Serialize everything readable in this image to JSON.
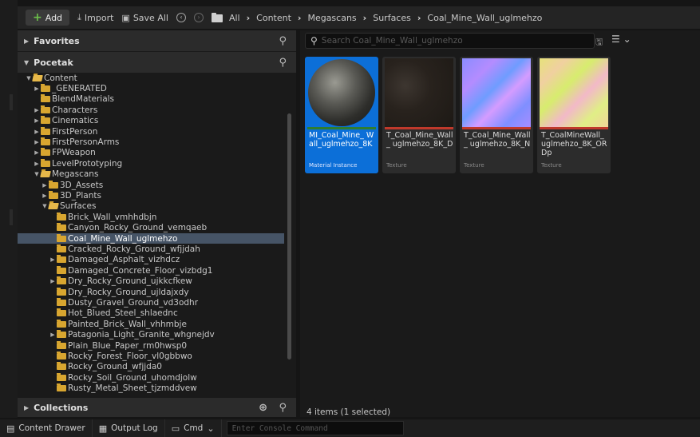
{
  "toolbar": {
    "add_label": "Add",
    "import_label": "Import",
    "save_all_label": "Save All",
    "breadcrumbs": [
      "All",
      "Content",
      "Megascans",
      "Surfaces",
      "Coal_Mine_Wall_uglmehzo"
    ]
  },
  "left_panel": {
    "favorites_label": "Favorites",
    "project_label": "Pocetak",
    "collections_label": "Collections",
    "tree": [
      {
        "label": "Content",
        "depth": 0,
        "expanded": true,
        "has_children": true
      },
      {
        "label": "_GENERATED",
        "depth": 1,
        "expanded": false,
        "has_children": true
      },
      {
        "label": "BlendMaterials",
        "depth": 1,
        "expanded": false,
        "has_children": false
      },
      {
        "label": "Characters",
        "depth": 1,
        "expanded": false,
        "has_children": true
      },
      {
        "label": "Cinematics",
        "depth": 1,
        "expanded": false,
        "has_children": true
      },
      {
        "label": "FirstPerson",
        "depth": 1,
        "expanded": false,
        "has_children": true
      },
      {
        "label": "FirstPersonArms",
        "depth": 1,
        "expanded": false,
        "has_children": true
      },
      {
        "label": "FPWeapon",
        "depth": 1,
        "expanded": false,
        "has_children": true
      },
      {
        "label": "LevelPrototyping",
        "depth": 1,
        "expanded": false,
        "has_children": true
      },
      {
        "label": "Megascans",
        "depth": 1,
        "expanded": true,
        "has_children": true
      },
      {
        "label": "3D_Assets",
        "depth": 2,
        "expanded": false,
        "has_children": true
      },
      {
        "label": "3D_Plants",
        "depth": 2,
        "expanded": false,
        "has_children": true
      },
      {
        "label": "Surfaces",
        "depth": 2,
        "expanded": true,
        "has_children": true
      },
      {
        "label": "Brick_Wall_vmhhdbjn",
        "depth": 3,
        "expanded": false,
        "has_children": false
      },
      {
        "label": "Canyon_Rocky_Ground_vemqaeb",
        "depth": 3,
        "expanded": false,
        "has_children": false
      },
      {
        "label": "Coal_Mine_Wall_uglmehzo",
        "depth": 3,
        "expanded": false,
        "has_children": false,
        "selected": true
      },
      {
        "label": "Cracked_Rocky_Ground_wfjjdah",
        "depth": 3,
        "expanded": false,
        "has_children": false
      },
      {
        "label": "Damaged_Asphalt_vizhdcz",
        "depth": 3,
        "expanded": false,
        "has_children": true
      },
      {
        "label": "Damaged_Concrete_Floor_vizbdg1",
        "depth": 3,
        "expanded": false,
        "has_children": false
      },
      {
        "label": "Dry_Rocky_Ground_ujkkcfkew",
        "depth": 3,
        "expanded": false,
        "has_children": true
      },
      {
        "label": "Dry_Rocky_Ground_ujldajxdy",
        "depth": 3,
        "expanded": false,
        "has_children": false
      },
      {
        "label": "Dusty_Gravel_Ground_vd3odhr",
        "depth": 3,
        "expanded": false,
        "has_children": false
      },
      {
        "label": "Hot_Blued_Steel_shlaednc",
        "depth": 3,
        "expanded": false,
        "has_children": false
      },
      {
        "label": "Painted_Brick_Wall_vhhmbje",
        "depth": 3,
        "expanded": false,
        "has_children": false
      },
      {
        "label": "Patagonia_Light_Granite_whgnejdv",
        "depth": 3,
        "expanded": false,
        "has_children": true
      },
      {
        "label": "Plain_Blue_Paper_rm0hwsp0",
        "depth": 3,
        "expanded": false,
        "has_children": false
      },
      {
        "label": "Rocky_Forest_Floor_vl0gbbwo",
        "depth": 3,
        "expanded": false,
        "has_children": false
      },
      {
        "label": "Rocky_Ground_wfjjda0",
        "depth": 3,
        "expanded": false,
        "has_children": false
      },
      {
        "label": "Rocky_Soil_Ground_uhomdjolw",
        "depth": 3,
        "expanded": false,
        "has_children": false
      },
      {
        "label": "Rusty_Metal_Sheet_tjzmddvew",
        "depth": 3,
        "expanded": false,
        "has_children": false
      }
    ]
  },
  "right_panel": {
    "search_placeholder": "Search Coal_Mine_Wall_uglmehzo",
    "status": "4 items (1 selected)",
    "assets": [
      {
        "name": "MI_Coal_Mine_ Wall_uglmehzo_8K",
        "type": "Material Instance",
        "selected": true,
        "bar_color": "#2f7d2f"
      },
      {
        "name": "T_Coal_Mine_Wall_ uglmehzo_8K_D",
        "type": "Texture",
        "selected": false,
        "bar_color": "#c0392b"
      },
      {
        "name": "T_Coal_Mine_Wall_ uglmehzo_8K_N",
        "type": "Texture",
        "selected": false,
        "bar_color": "#c0392b"
      },
      {
        "name": "T_CoalMineWall_ uglmehzo_8K_OR Dp",
        "type": "Texture",
        "selected": false,
        "bar_color": "#c0392b"
      }
    ]
  },
  "bottom_bar": {
    "content_drawer_label": "Content Drawer",
    "output_log_label": "Output Log",
    "cmd_label": "Cmd",
    "console_placeholder": "Enter Console Command"
  }
}
